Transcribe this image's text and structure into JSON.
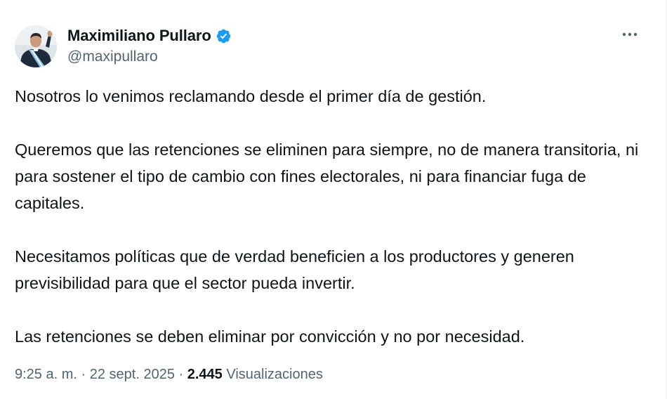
{
  "tweet": {
    "author": {
      "display_name": "Maximiliano Pullaro",
      "handle": "@maxipullaro",
      "verified": true,
      "verified_color": "#1d9bf0",
      "avatar_icon": "profile-photo"
    },
    "more_icon": "more-horizontal-icon",
    "paragraphs": [
      "Nosotros lo venimos reclamando desde el primer día de gestión.",
      "Queremos que las retenciones se eliminen para siempre, no de manera transitoria, ni para sostener el tipo de cambio con fines electorales, ni para financiar fuga de capitales.",
      "Necesitamos políticas que de verdad beneficien a los productores y generen previsibilidad para que el sector pueda invertir.",
      "Las retenciones se deben eliminar por convicción y no por necesidad."
    ],
    "meta": {
      "time": "9:25 a. m.",
      "separator": "·",
      "date": "22 sept. 2025",
      "views_count": "2.445",
      "views_label": "Visualizaciones"
    }
  },
  "colors": {
    "text_primary": "#0f1419",
    "text_secondary": "#536471",
    "accent": "#1d9bf0"
  }
}
